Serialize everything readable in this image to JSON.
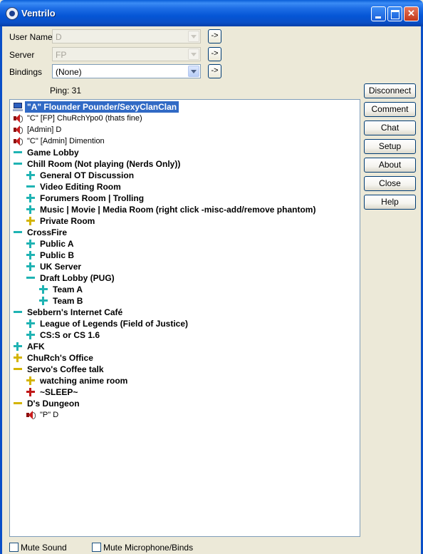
{
  "window": {
    "title": "Ventrilo"
  },
  "form": {
    "username_label": "User Name",
    "username_value": "D",
    "server_label": "Server",
    "server_value": "FP",
    "bindings_label": "Bindings",
    "bindings_value": "(None)",
    "go_label": "->"
  },
  "ping": "Ping: 31",
  "buttons": [
    "Disconnect",
    "Comment",
    "Chat",
    "Setup",
    "About",
    "Close",
    "Help"
  ],
  "tree": [
    {
      "text": "\"A\" Flounder Pounder/SexyClanClan",
      "kind": "me",
      "indent": 0,
      "selected": true
    },
    {
      "text": "\"C\" [FP] ChuRchYpo0 (thats fine)",
      "kind": "user",
      "indent": 0
    },
    {
      "text": "[Admin] D",
      "kind": "user",
      "indent": 0
    },
    {
      "text": "\"C\" [Admin] Dimention",
      "kind": "user",
      "indent": 0
    },
    {
      "text": "Game Lobby",
      "kind": "channel",
      "icon": "minus",
      "color": "cyan",
      "indent": 0
    },
    {
      "text": "Chill Room (Not playing (Nerds Only))",
      "kind": "channel",
      "icon": "minus",
      "color": "cyan",
      "indent": 0
    },
    {
      "text": "General OT Discussion",
      "kind": "channel",
      "icon": "plus",
      "color": "cyan",
      "indent": 1
    },
    {
      "text": "Video Editing Room",
      "kind": "channel",
      "icon": "minus",
      "color": "cyan",
      "indent": 1
    },
    {
      "text": "Forumers Room | Trolling",
      "kind": "channel",
      "icon": "plus",
      "color": "cyan",
      "indent": 1
    },
    {
      "text": "Music | Movie | Media Room (right click -misc-add/remove phantom)",
      "kind": "channel",
      "icon": "plus",
      "color": "cyan",
      "indent": 1
    },
    {
      "text": "Private Room",
      "kind": "channel",
      "icon": "plus",
      "color": "yellow",
      "indent": 1
    },
    {
      "text": "CrossFire",
      "kind": "channel",
      "icon": "minus",
      "color": "cyan",
      "indent": 0
    },
    {
      "text": "Public A",
      "kind": "channel",
      "icon": "plus",
      "color": "cyan",
      "indent": 1
    },
    {
      "text": "Public B",
      "kind": "channel",
      "icon": "plus",
      "color": "cyan",
      "indent": 1
    },
    {
      "text": "UK Server",
      "kind": "channel",
      "icon": "plus",
      "color": "cyan",
      "indent": 1
    },
    {
      "text": "Draft Lobby (PUG)",
      "kind": "channel",
      "icon": "minus",
      "color": "cyan",
      "indent": 1
    },
    {
      "text": "Team A",
      "kind": "channel",
      "icon": "plus",
      "color": "cyan",
      "indent": 2
    },
    {
      "text": "Team B",
      "kind": "channel",
      "icon": "plus",
      "color": "cyan",
      "indent": 2
    },
    {
      "text": "Sebbern's Internet Café",
      "kind": "channel",
      "icon": "minus",
      "color": "cyan",
      "indent": 0
    },
    {
      "text": "League of Legends (Field of Justice)",
      "kind": "channel",
      "icon": "plus",
      "color": "cyan",
      "indent": 1
    },
    {
      "text": "CS:S or CS 1.6",
      "kind": "channel",
      "icon": "plus",
      "color": "cyan",
      "indent": 1
    },
    {
      "text": "AFK",
      "kind": "channel",
      "icon": "plus",
      "color": "cyan",
      "indent": 0
    },
    {
      "text": "ChuRch's Office",
      "kind": "channel",
      "icon": "plus",
      "color": "yellow",
      "indent": 0
    },
    {
      "text": "Servo's Coffee talk",
      "kind": "channel",
      "icon": "minus",
      "color": "yellow",
      "indent": 0
    },
    {
      "text": "watching anime room",
      "kind": "channel",
      "icon": "plus",
      "color": "yellow",
      "indent": 1
    },
    {
      "text": "~SLEEP~",
      "kind": "channel",
      "icon": "plus",
      "color": "red",
      "indent": 1
    },
    {
      "text": "D's Dungeon",
      "kind": "channel",
      "icon": "minus",
      "color": "yellow",
      "indent": 0
    },
    {
      "text": "\"P\" D",
      "kind": "user",
      "indent": 1
    }
  ],
  "footer": {
    "mute_sound": "Mute Sound",
    "mute_mic": "Mute Microphone/Binds"
  }
}
